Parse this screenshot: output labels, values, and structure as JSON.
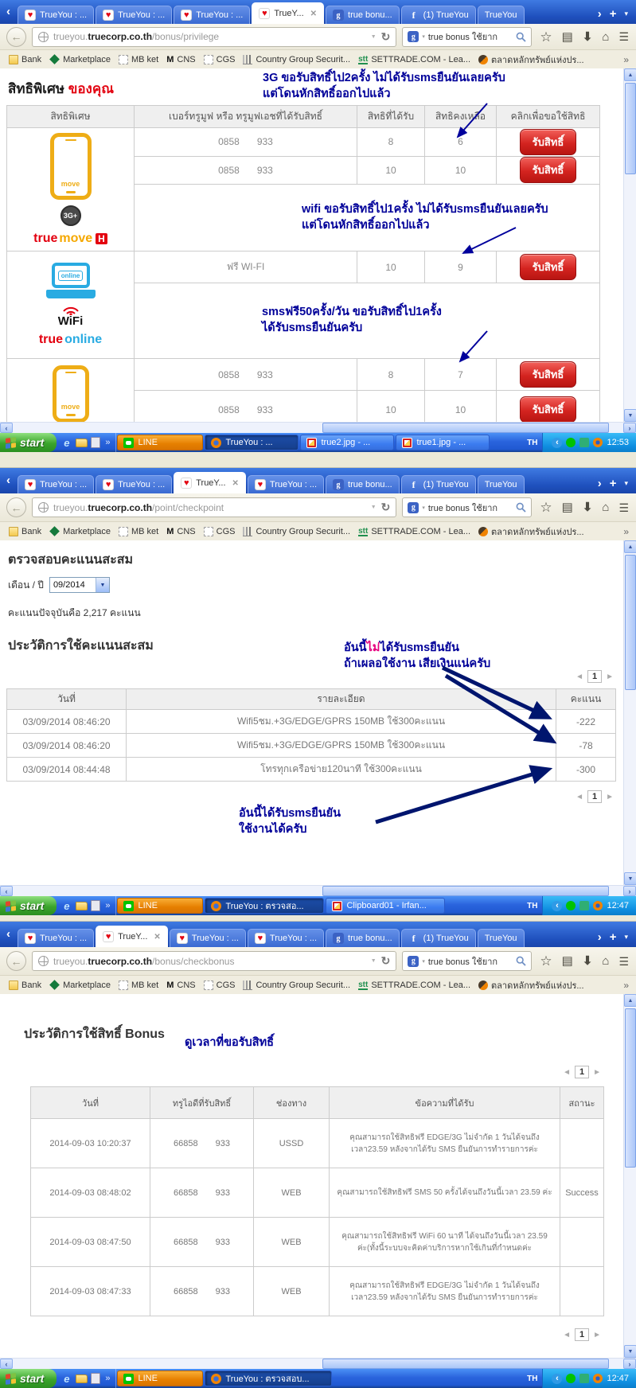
{
  "icons": {
    "close": "✕",
    "chevron_left": "‹",
    "chevron_right": "›",
    "plus": "+",
    "caret_down": "▾",
    "back_arrow": "←",
    "url_dropdown": "▼",
    "reload": "↻",
    "star": "☆",
    "clipboard": "▤",
    "download_arrow": "⬇",
    "home": "⌂",
    "menu": "☰",
    "overflow": "»",
    "heart": "♥",
    "google_g": "g",
    "facebook_f": "f",
    "cns_m": "M",
    "stt": "stt",
    "quick_ie": "e",
    "scroll_up": "▲",
    "scroll_down": "▼",
    "pager_left": "◄",
    "pager_right": "►"
  },
  "search": {
    "query": "true bonus ใช้ยาก"
  },
  "bookmarks": [
    "Bank",
    "Marketplace",
    "MB ket",
    "CNS",
    "CGS",
    "Country Group Securit...",
    "SETTRADE.COM - Lea...",
    "ตลาดหลักทรัพย์แห่งปร..."
  ],
  "window1": {
    "tabs": [
      "TrueYou : ...",
      "TrueYou : ...",
      "TrueYou : ...",
      "TrueY...",
      "true bonu...",
      "(1) TrueYou",
      "TrueYou"
    ],
    "url": {
      "subdomain": "trueyou.",
      "domain": "truecorp.co.th",
      "path": "/bonus/privilege"
    },
    "page": {
      "title": "สิทธิพิเศษ",
      "title_accent": "ของคุณ",
      "ann_3g": [
        "3G ขอรับสิทธิ์ไป2ครั้ง ไม่ได้รับsmsยืนยันเลยครับ",
        "แต่โดนหักสิทธิ์ออกไปแล้ว"
      ],
      "ann_wifi": [
        "wifi ขอรับสิทธิ์ไป1ครั้ง ไม่ได้รับsmsยืนยันเลยครับ",
        "แต่โดนหักสิทธิ์ออกไปแล้ว"
      ],
      "ann_sms": [
        "smsฟรี50ครั้ง/วัน ขอรับสิทธิ์ไป1ครั้ง",
        "ได้รับsmsยืนยันครับ"
      ],
      "headers": [
        "สิทธิพิเศษ",
        "เบอร์ทรูมูฟ หรือ ทรูมูฟเอชที่ได้รับสิทธิ์",
        "สิทธิที่ได้รับ",
        "สิทธิคงเหลือ",
        "คลิกเพื่อขอใช้สิทธิ"
      ],
      "button": "รับสิทธิ์",
      "rows": [
        {
          "p1": "0858",
          "p2": "933",
          "got": "8",
          "left": "6"
        },
        {
          "p1": "0858",
          "p2": "933",
          "got": "10",
          "left": "10"
        },
        {
          "p1": "0858",
          "p2": "933",
          "got": "8",
          "left": "7"
        },
        {
          "p1": "0858",
          "p2": "933",
          "got": "10",
          "left": "10"
        }
      ],
      "wifi_row": {
        "name": "ฟรี WI-FI",
        "got": "10",
        "left": "9"
      },
      "logos": {
        "move": "move",
        "g3": "3G+",
        "tm_true": "true",
        "tm_move": "move",
        "tm_h": "H",
        "online": "online",
        "wifi": "WiFi",
        "to_true": "true",
        "to_online": "online"
      }
    }
  },
  "window2": {
    "tabs": [
      "TrueYou : ...",
      "TrueYou : ...",
      "TrueY...",
      "TrueYou : ...",
      "true bonu...",
      "(1) TrueYou",
      "TrueYou"
    ],
    "url": {
      "subdomain": "trueyou.",
      "domain": "truecorp.co.th",
      "path": "/point/checkpoint"
    },
    "page": {
      "title": "ตรวจสอบคะแนนสะสม",
      "month_label": "เดือน / ปี",
      "month_value": "09/2014",
      "points_line": "คะแนนปัจจุบันคือ 2,217 คะแนน",
      "history_title": "ประวัติการใช้คะแนนสะสม",
      "ann_top": {
        "pre": "อันนี้",
        "no": "ไม่",
        "post": "ได้รับsmsยืนยัน",
        "line2": "ถ้าเผลอใช้งาน เสียเงินแน่ครับ"
      },
      "ann_bottom": [
        "อันนี้ได้รับsmsยืนยัน",
        "ใช้งานได้ครับ"
      ],
      "page_number": "1",
      "headers": [
        "วันที่",
        "รายละเอียด",
        "คะแนน"
      ],
      "rows": [
        {
          "date": "03/09/2014 08:46:20",
          "desc": "Wifi5ชม.+3G/EDGE/GPRS 150MB ใช้300คะแนน",
          "points": "-222"
        },
        {
          "date": "03/09/2014 08:46:20",
          "desc": "Wifi5ชม.+3G/EDGE/GPRS 150MB ใช้300คะแนน",
          "points": "-78"
        },
        {
          "date": "03/09/2014 08:44:48",
          "desc": "โทรทุกเครือข่าย120นาที ใช้300คะแนน",
          "points": "-300"
        }
      ]
    }
  },
  "window3": {
    "tabs": [
      "TrueYou : ...",
      "TrueY...",
      "TrueYou : ...",
      "TrueYou : ...",
      "true bonu...",
      "(1) TrueYou",
      "TrueYou"
    ],
    "url": {
      "subdomain": "trueyou.",
      "domain": "truecorp.co.th",
      "path": "/bonus/checkbonus"
    },
    "page": {
      "title": "ประวัติการใช้สิทธิ์ Bonus",
      "annotation": "ดูเวลาที่ขอรับสิทธิ์",
      "page_number": "1",
      "headers": [
        "วันที่",
        "ทรูไอดีที่รับสิทธิ์",
        "ช่องทาง",
        "ข้อความที่ได้รับ",
        "สถานะ"
      ],
      "rows": [
        {
          "date": "2014-09-03 10:20:37",
          "id1": "66858",
          "id2": "933",
          "channel": "USSD",
          "message": "คุณสามารถใช้สิทธิฟรี EDGE/3G ไม่จำกัด 1 วันได้จนถึงเวลา23.59 หลังจากได้รับ SMS ยืนยันการทำรายการค่ะ",
          "status": ""
        },
        {
          "date": "2014-09-03 08:48:02",
          "id1": "66858",
          "id2": "933",
          "channel": "WEB",
          "message": "คุณสามารถใช้สิทธิฟรี SMS 50 ครั้งได้จนถึงวันนี้เวลา 23.59 ค่ะ",
          "status": "Success"
        },
        {
          "date": "2014-09-03 08:47:50",
          "id1": "66858",
          "id2": "933",
          "channel": "WEB",
          "message": "คุณสามารถใช้สิทธิฟรี WiFi 60 นาที ได้จนถึงวันนี้เวลา 23.59 ค่ะ(ทั้งนี้ระบบจะคิดค่าบริการหากใช้เกินที่กำหนดค่ะ",
          "status": ""
        },
        {
          "date": "2014-09-03 08:47:33",
          "id1": "66858",
          "id2": "933",
          "channel": "WEB",
          "message": "คุณสามารถใช้สิทธิฟรี EDGE/3G ไม่จำกัด 1 วันได้จนถึงเวลา23.59 หลังจากได้รับ SMS ยืนยันการทำรายการค่ะ",
          "status": ""
        }
      ]
    }
  },
  "taskbar1": {
    "start": "start",
    "lang": "TH",
    "clock": "12:53",
    "buttons": [
      {
        "label": "LINE"
      },
      {
        "label": "TrueYou : ..."
      },
      {
        "label": "true2.jpg - ..."
      },
      {
        "label": "true1.jpg - ..."
      }
    ]
  },
  "taskbar2": {
    "start": "start",
    "lang": "TH",
    "clock": "12:47",
    "buttons": [
      {
        "label": "LINE"
      },
      {
        "label": "TrueYou : ตรวจสอ..."
      },
      {
        "label": "Clipboard01 - Irfan..."
      }
    ]
  },
  "taskbar3": {
    "start": "start",
    "lang": "TH",
    "clock": "12:47",
    "buttons": [
      {
        "label": "LINE"
      },
      {
        "label": "TrueYou : ตรวจสอบ..."
      }
    ]
  }
}
